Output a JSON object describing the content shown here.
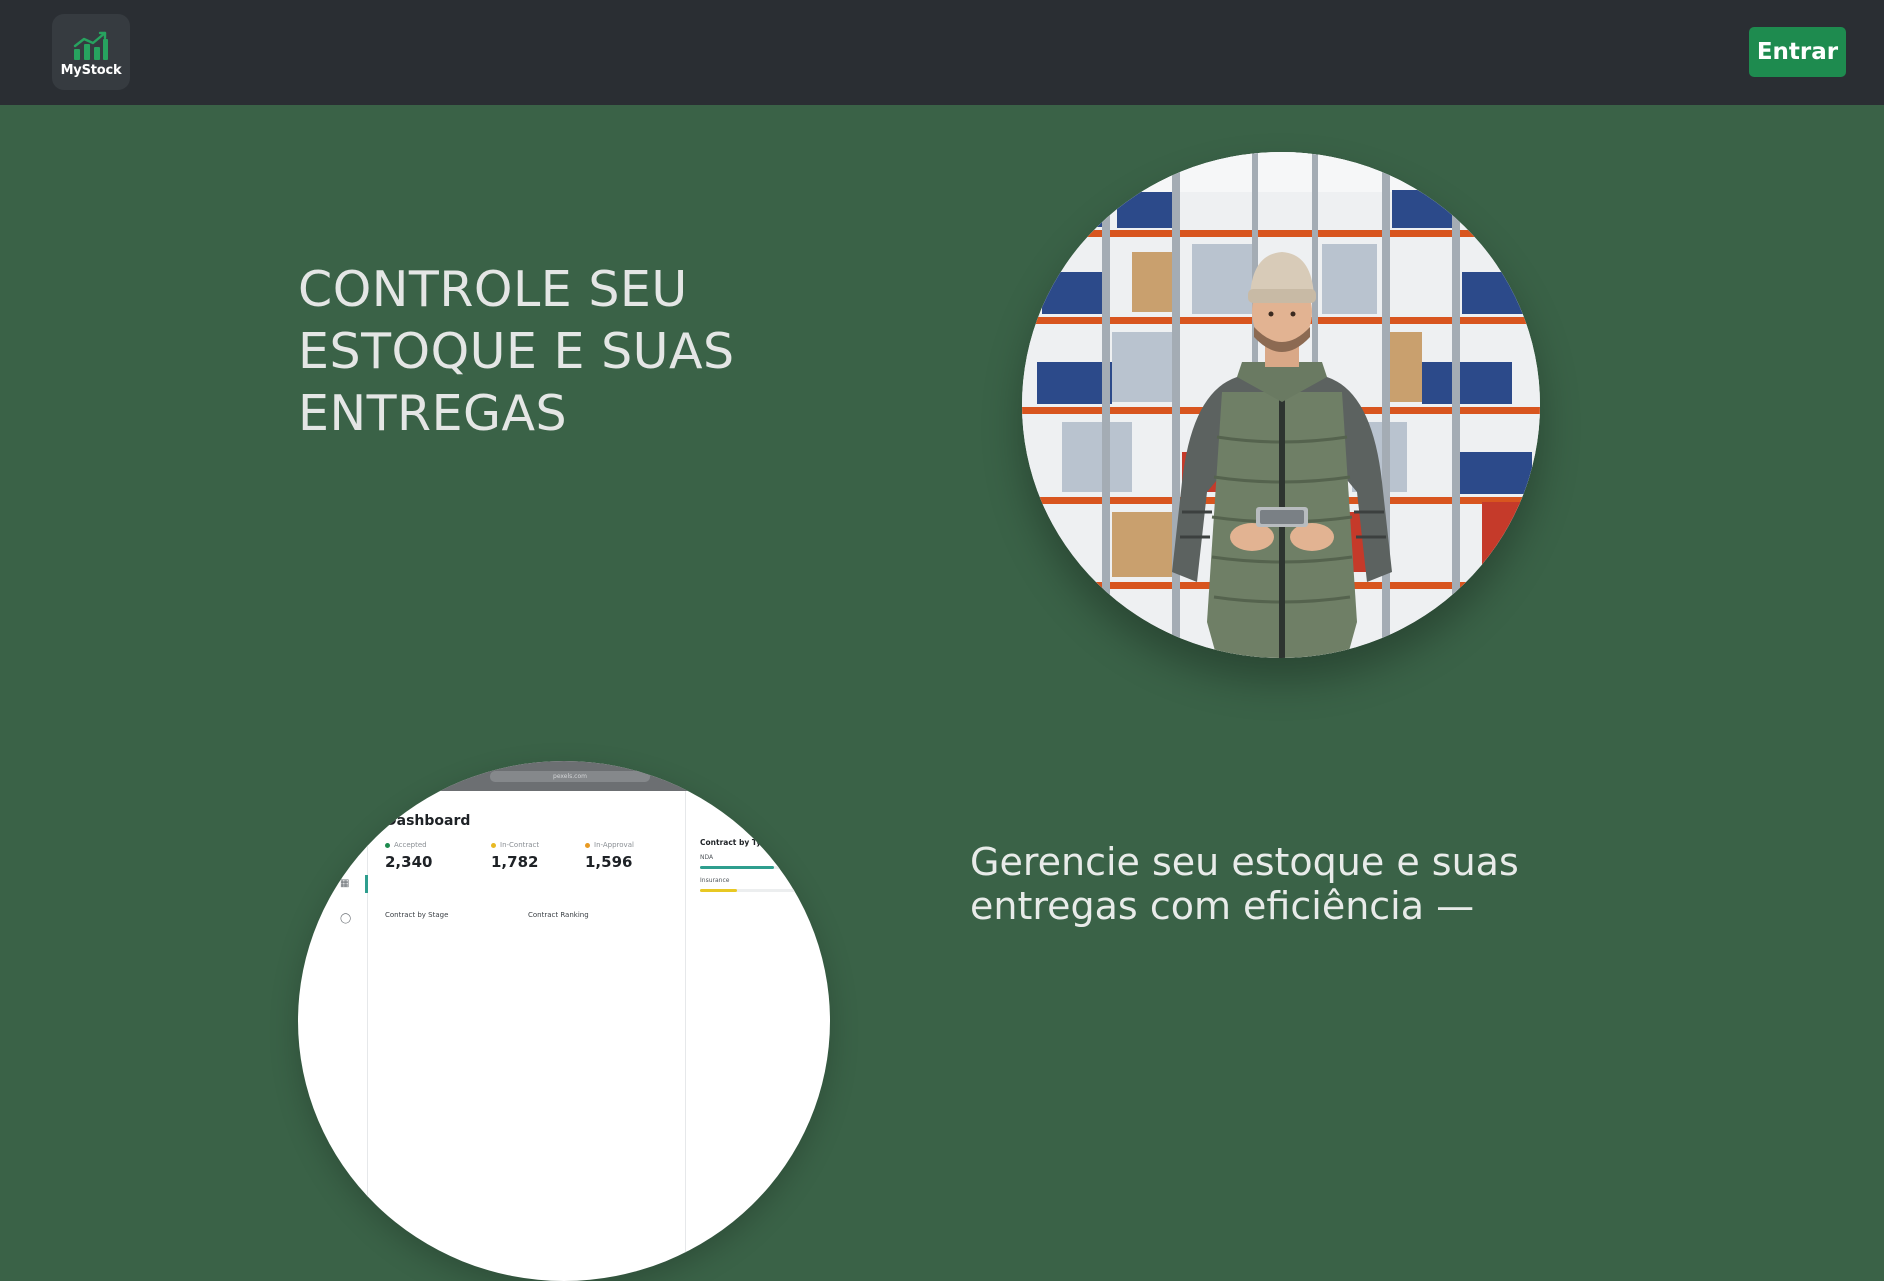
{
  "header": {
    "logo_text": "MyStock",
    "logo_icon": "chart-growth-icon",
    "login_label": "Entrar",
    "accent_color": "#1e8b4f"
  },
  "hero": {
    "title": "CONTROLE SEU ESTOQUE E SUAS ENTREGAS",
    "image_subject": "warehouse worker holding tablet"
  },
  "section2": {
    "subtitle": "Gerencie seu estoque e suas entregas com eficiência —",
    "dashboard_image": {
      "url_text": "pexels.com",
      "title": "Dashboard",
      "stats": [
        {
          "label": "Accepted",
          "value": "2,340",
          "color": "#1e8b4f"
        },
        {
          "label": "In-Contract",
          "value": "1,782",
          "color": "#e8b923"
        },
        {
          "label": "In-Approval",
          "value": "1,596",
          "color": "#e89a23"
        }
      ],
      "contract_type": {
        "title": "Contract by Type",
        "rows": [
          {
            "label": "NDA",
            "pct": "70%",
            "fraction": 0.7,
            "color": "#2e9e8e"
          },
          {
            "label": "Insurance",
            "pct": "35%",
            "fraction": 0.35,
            "color": "#e8c823"
          }
        ]
      },
      "section_headings": [
        "Contract by Stage",
        "Contract Ranking"
      ]
    }
  },
  "colors": {
    "background": "#3a6247",
    "topbar": "#2a2e33"
  }
}
